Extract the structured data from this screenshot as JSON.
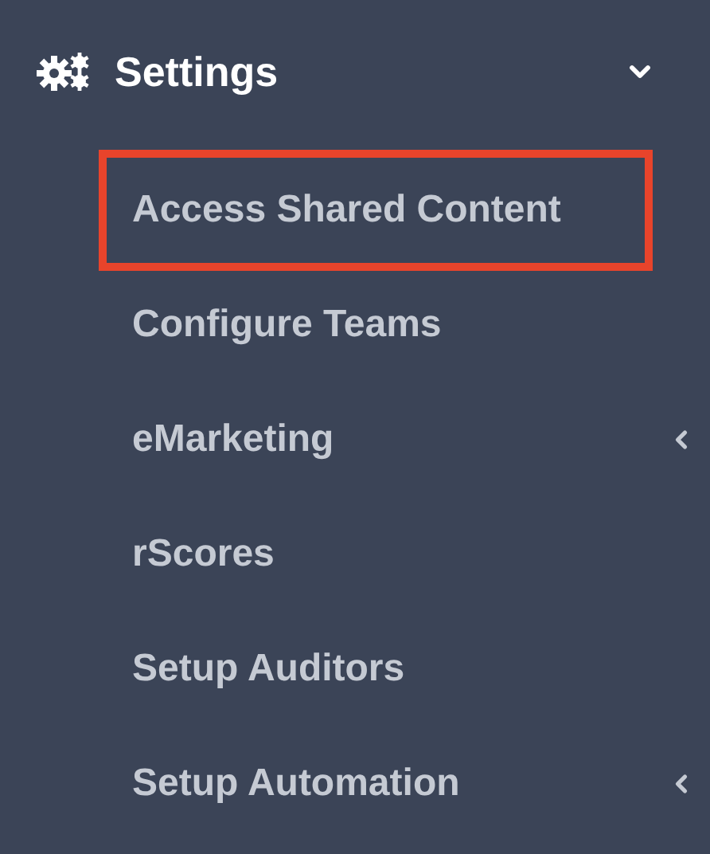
{
  "section": {
    "title": "Settings",
    "expanded": true
  },
  "items": [
    {
      "label": "Access Shared Content",
      "highlighted": true,
      "has_submenu": false
    },
    {
      "label": "Configure Teams",
      "highlighted": false,
      "has_submenu": false
    },
    {
      "label": "eMarketing",
      "highlighted": false,
      "has_submenu": true
    },
    {
      "label": "rScores",
      "highlighted": false,
      "has_submenu": false
    },
    {
      "label": "Setup Auditors",
      "highlighted": false,
      "has_submenu": false
    },
    {
      "label": "Setup Automation",
      "highlighted": false,
      "has_submenu": true
    }
  ]
}
